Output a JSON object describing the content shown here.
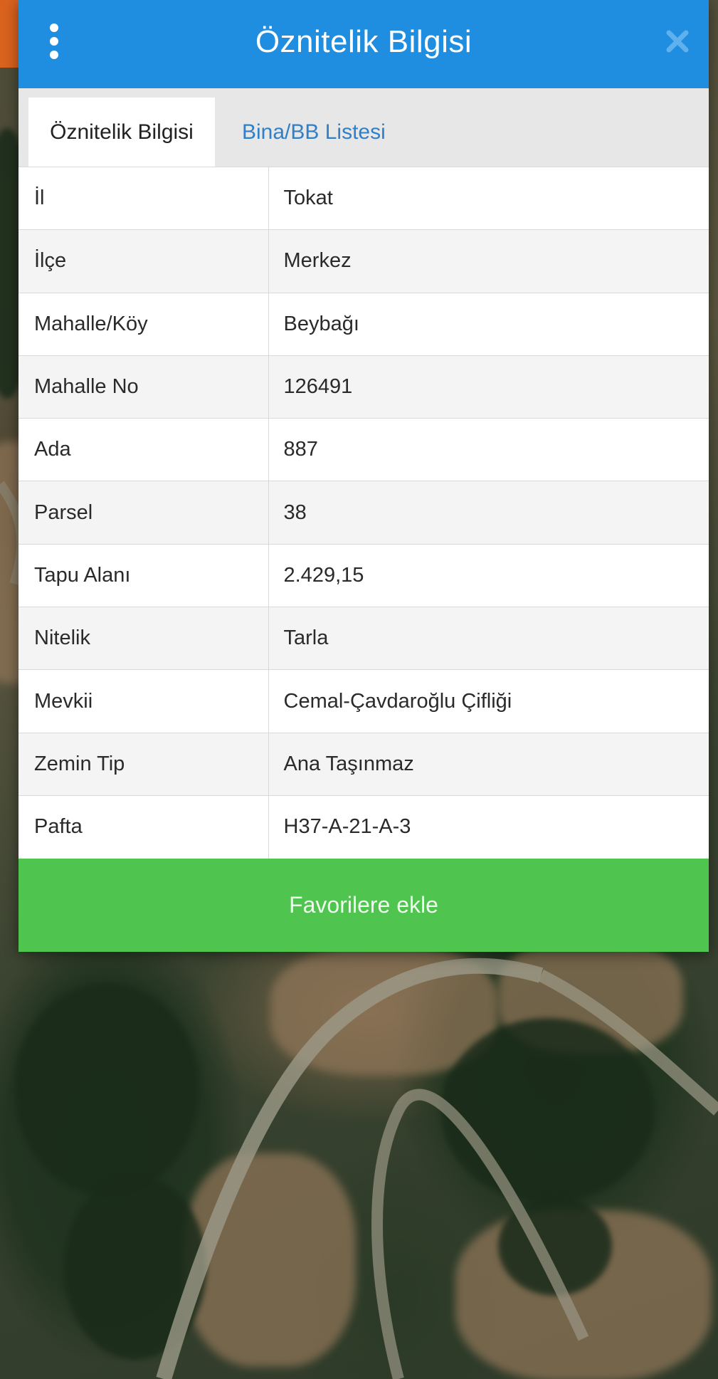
{
  "dialog": {
    "title": "Öznitelik Bilgisi",
    "menu_icon": "vertical-dots-icon",
    "close_icon": "close-icon"
  },
  "tabs": [
    {
      "label": "Öznitelik Bilgisi",
      "active": true
    },
    {
      "label": "Bina/BB Listesi",
      "active": false
    }
  ],
  "attributes": [
    {
      "key": "İl",
      "value": "Tokat"
    },
    {
      "key": "İlçe",
      "value": "Merkez"
    },
    {
      "key": "Mahalle/Köy",
      "value": "Beybağı"
    },
    {
      "key": "Mahalle No",
      "value": "126491"
    },
    {
      "key": "Ada",
      "value": "887"
    },
    {
      "key": "Parsel",
      "value": "38"
    },
    {
      "key": "Tapu Alanı",
      "value": "2.429,15"
    },
    {
      "key": "Nitelik",
      "value": "Tarla"
    },
    {
      "key": "Mevkii",
      "value": "Cemal-Çavdaroğlu Çifliği"
    },
    {
      "key": "Zemin Tip",
      "value": "Ana Taşınmaz"
    },
    {
      "key": "Pafta",
      "value": "H37-A-21-A-3"
    }
  ],
  "favorite_button": {
    "label": "Favorilere ekle"
  },
  "colors": {
    "header": "#1f8ee0",
    "tab_link": "#2f7fc9",
    "favorite": "#4fc54f"
  }
}
